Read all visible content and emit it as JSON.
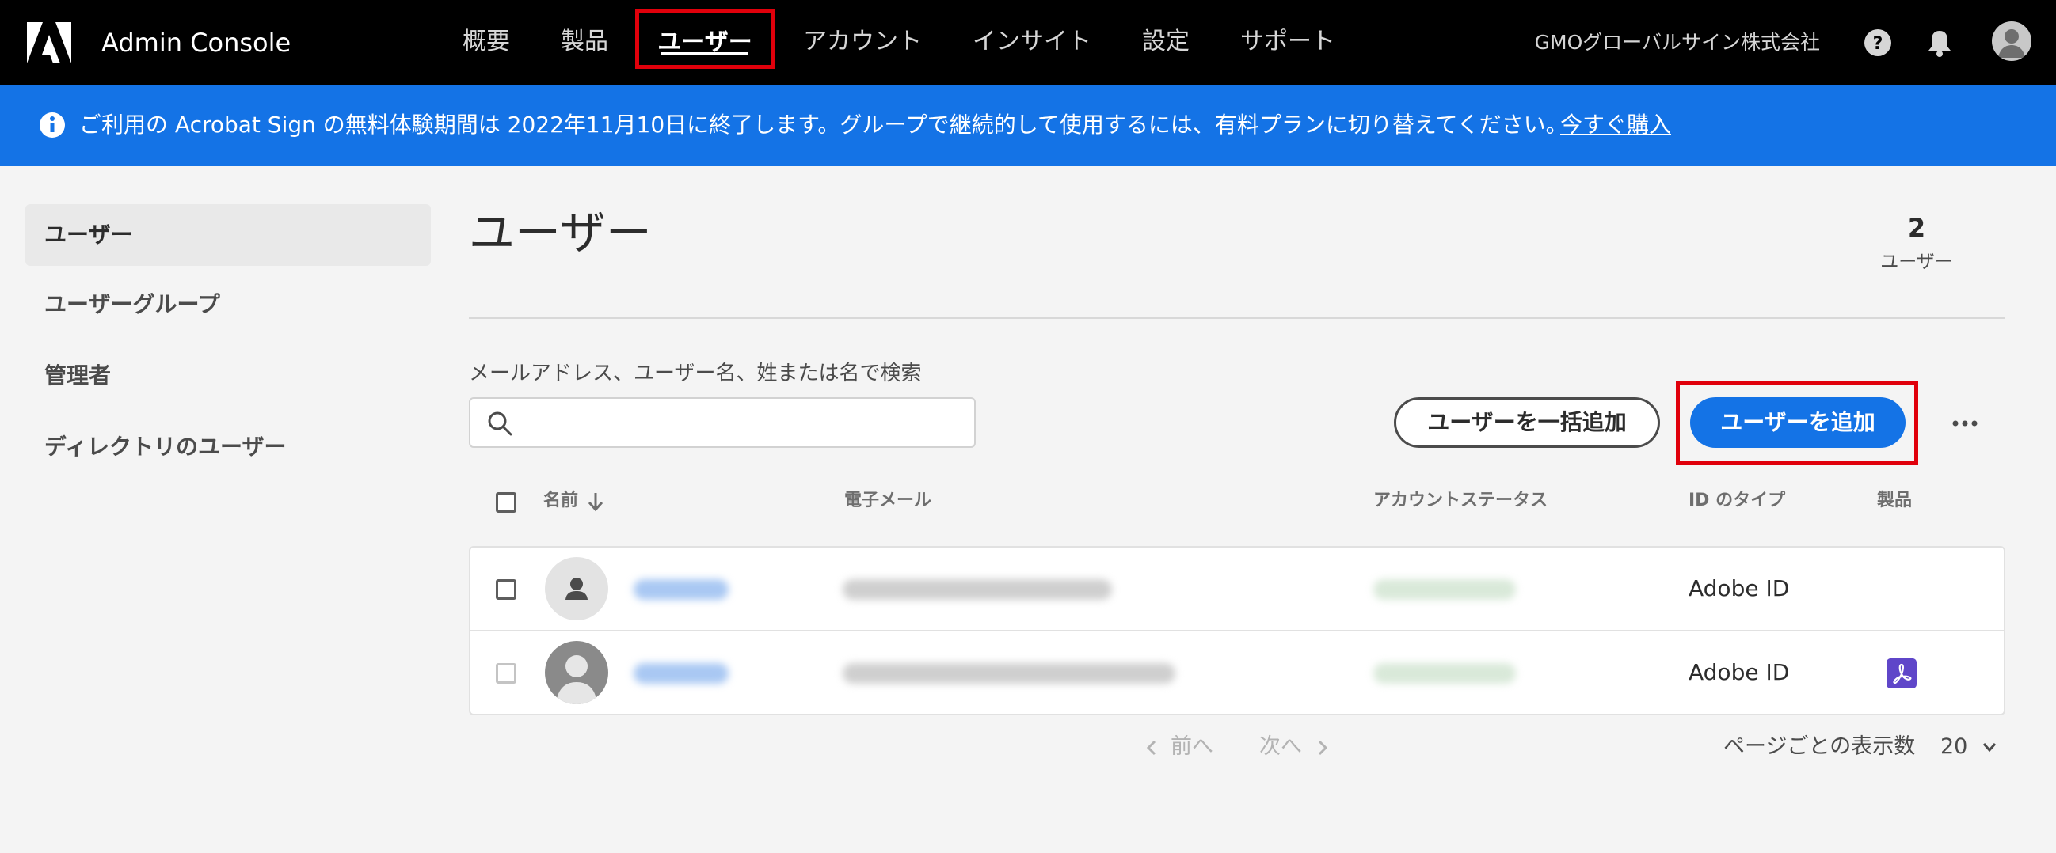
{
  "header": {
    "app_title": "Admin Console",
    "nav": [
      "概要",
      "製品",
      "ユーザー",
      "アカウント",
      "インサイト",
      "設定",
      "サポート"
    ],
    "active_nav": "ユーザー",
    "organization": "GMOグローバルサイン株式会社",
    "icons": [
      "adobe-logo-icon",
      "help-icon",
      "bell-icon",
      "user-avatar-icon"
    ]
  },
  "banner": {
    "message": "ご利用の Acrobat Sign の無料体験期間は 2022年11月10日に終了します。グループで継続的して使用するには、有料プランに切り替えてください。",
    "link": "今すぐ購入",
    "background": "#1473e6"
  },
  "sidebar": {
    "items": [
      {
        "label": "ユーザー",
        "selected": true
      },
      {
        "label": "ユーザーグループ",
        "selected": false
      },
      {
        "label": "管理者",
        "selected": false
      },
      {
        "label": "ディレクトリのユーザー",
        "selected": false
      }
    ]
  },
  "main": {
    "title": "ユーザー",
    "count": "2",
    "count_label": "ユーザー",
    "search_label": "メールアドレス、ユーザー名、姓または名で検索",
    "search_value": "",
    "bulk_add_button": "ユーザーを一括追加",
    "add_user_button": "ユーザーを追加",
    "accent": "#1473e6",
    "highlight_color": "#e0000b"
  },
  "table": {
    "columns": [
      "名前",
      "電子メール",
      "アカウントステータス",
      "ID のタイプ",
      "製品"
    ],
    "sort_column": "名前",
    "rows": [
      {
        "id_type": "Adobe ID",
        "product_icon": null
      },
      {
        "id_type": "Adobe ID",
        "product_icon": "acrobat-icon"
      }
    ]
  },
  "pagination": {
    "prev": "前へ",
    "next": "次へ",
    "per_page_label": "ページごとの表示数",
    "per_page_value": "20"
  }
}
